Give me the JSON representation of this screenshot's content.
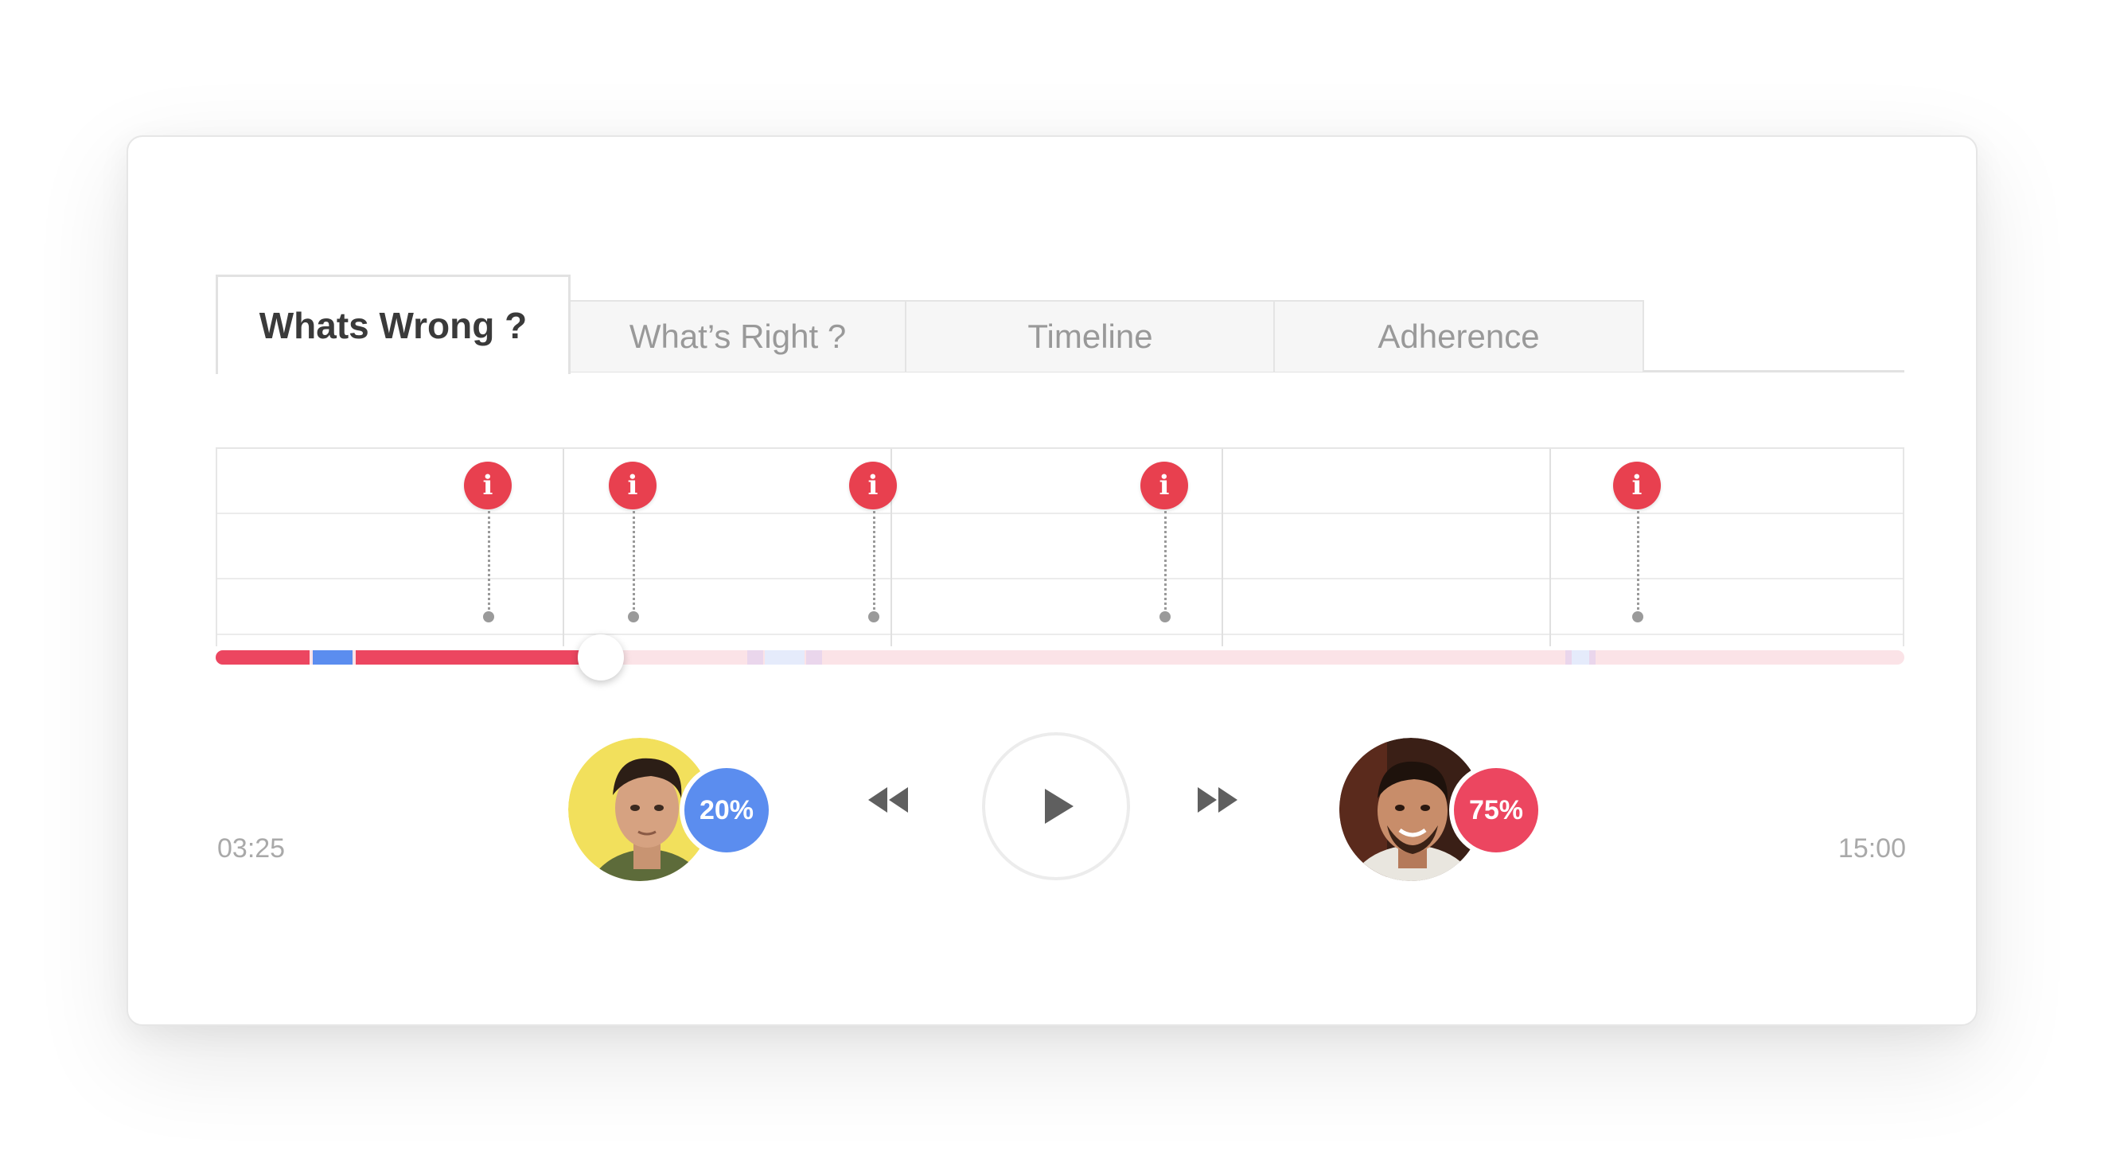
{
  "tabs": [
    {
      "label": "Whats Wrong ?",
      "active": true
    },
    {
      "label": "What’s Right ?",
      "active": false
    },
    {
      "label": "Timeline",
      "active": false
    },
    {
      "label": "Adherence",
      "active": false
    }
  ],
  "timeline": {
    "current_time": "03:25",
    "total_time": "15:00",
    "progress_fraction": 0.228,
    "marker_icon": "info-icon",
    "marker_glyph": "i",
    "marker_color": "#e8404f"
  },
  "participants": [
    {
      "name_icon": "avatar-left",
      "score": "20%",
      "score_color": "#5b8def"
    },
    {
      "name_icon": "avatar-right",
      "score": "75%",
      "score_color": "#ec4660"
    }
  ],
  "controls": {
    "rewind_icon": "rewind-icon",
    "play_icon": "play-icon",
    "forward_icon": "fast-forward-icon"
  },
  "colors": {
    "track_bg": "#fbe3e7",
    "track_red": "#ec4660",
    "track_blue": "#5b8def"
  }
}
